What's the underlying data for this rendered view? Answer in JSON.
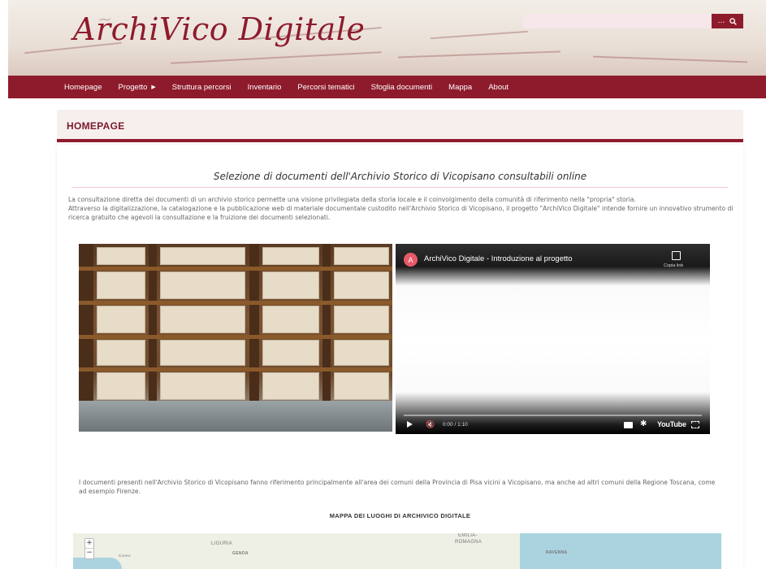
{
  "header": {
    "logo": "ArchiVico Digitale",
    "search": {
      "placeholder": "",
      "button_label": "...",
      "button_icon": "search-icon"
    }
  },
  "nav": {
    "items": [
      {
        "label": "Homepage"
      },
      {
        "label": "Progetto",
        "has_caret": true
      },
      {
        "label": "Struttura percorsi"
      },
      {
        "label": "Inventario"
      },
      {
        "label": "Percorsi tematici"
      },
      {
        "label": "Sfoglia documenti"
      },
      {
        "label": "Mappa"
      },
      {
        "label": "About"
      }
    ]
  },
  "page": {
    "title": "HOMEPAGE"
  },
  "content": {
    "subtitle": "Selezione di documenti dell'Archivio Storico di Vicopisano consultabili online",
    "intro_1": "La consultazione diretta dei documenti di un archivio storico permette una visione privilegiata della storia locale e il coinvolgimento della comunità di riferimento nella \"propria\" storia.",
    "intro_2": "Attraverso la digitalizzazione, la catalogazione e la pubblicazione web di materiale documentale custodito nell'Archivio Storico di Vicopisano, il progetto \"ArchiVico Digitale\" intende fornire un innovativo strumento di ricerca gratuito che agevoli la consultazione e la fruizione dei documenti selezionati.",
    "video": {
      "avatar": "A",
      "title": "ArchiVico Digitale - Introduzione al progetto",
      "copy_label": "Copia link",
      "time": "0:00 / 1:10",
      "brand": "YouTube"
    },
    "description": "I documenti presenti nell'Archivio Storico di Vicopisano fanno riferimento principalmente all'area dei comuni della Provincia di Pisa vicini a Vicopisano, ma anche ad altri comuni della Regione Toscana, come ad esempio Firenze.",
    "map_title": "MAPPA DEI LUOGHI DI ARCHIVICO DIGITALE",
    "map": {
      "labels": [
        "LIGURIA",
        "GENOA",
        "EMILIA-",
        "ROMAGNA",
        "RAVENNA",
        "Cuneo"
      ],
      "zoom_in": "+",
      "zoom_out": "−"
    }
  }
}
